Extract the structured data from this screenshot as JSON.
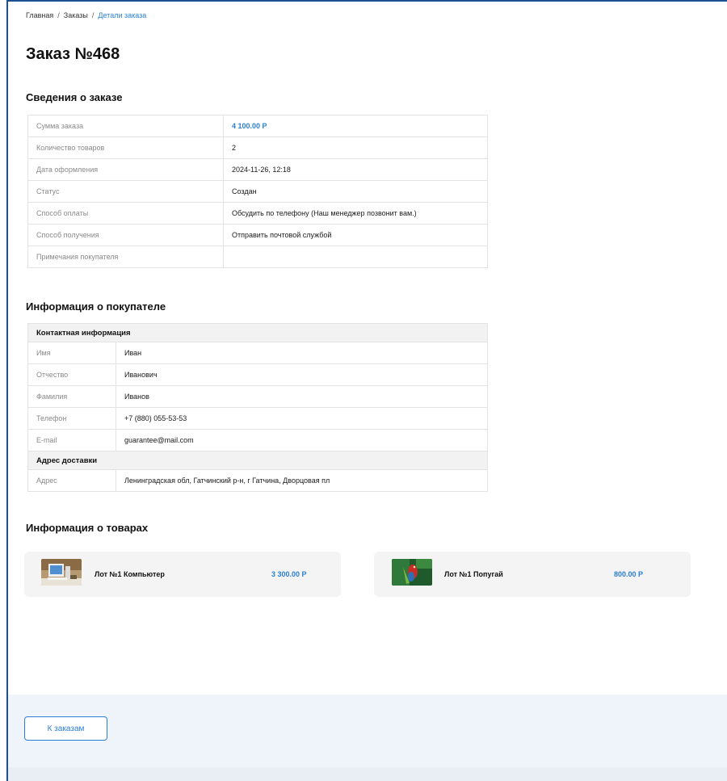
{
  "breadcrumb": {
    "items": [
      "Главная",
      "Заказы",
      "Детали заказа"
    ],
    "separator": "/"
  },
  "page_title": "Заказ №468",
  "order_section": {
    "title": "Сведения о заказе",
    "rows": [
      {
        "label": "Сумма заказа",
        "value": "4 100.00 Р"
      },
      {
        "label": "Количество товаров",
        "value": "2"
      },
      {
        "label": "Дата оформления",
        "value": "2024-11-26, 12:18"
      },
      {
        "label": "Статус",
        "value": "Создан"
      },
      {
        "label": "Способ оплаты",
        "value": "Обсудить по телефону (Наш менеджер позвонит вам.)"
      },
      {
        "label": "Способ получения",
        "value": "Отправить почтовой службой"
      },
      {
        "label": "Примечания покупателя",
        "value": ""
      }
    ]
  },
  "buyer_section": {
    "title": "Информация о покупателе",
    "contact_header": "Контактная информация",
    "contact_rows": [
      {
        "label": "Имя",
        "value": "Иван"
      },
      {
        "label": "Отчество",
        "value": "Иванович"
      },
      {
        "label": "Фамилия",
        "value": "Иванов"
      },
      {
        "label": "Телефон",
        "value": "+7 (880) 055-53-53"
      },
      {
        "label": "E-mail",
        "value": "guarantee@mail.com"
      }
    ],
    "address_header": "Адрес доставки",
    "address_row": {
      "label": "Адрес",
      "value": "Ленинградская обл, Гатчинский р-н, г Гатчина, Дворцовая пл"
    }
  },
  "products_section": {
    "title": "Информация о товарах",
    "items": [
      {
        "name": "Лот №1 Компьютер",
        "price": "3 300.00 Р",
        "image": "computer-photo"
      },
      {
        "name": "Лот №1 Попугай",
        "price": "800.00 Р",
        "image": "parrot-photo"
      }
    ]
  },
  "footer": {
    "back_button": "К заказам"
  },
  "colors": {
    "accent": "#2a7fd4",
    "frame": "#1d4f91",
    "footer_bg": "#eff4fb"
  }
}
